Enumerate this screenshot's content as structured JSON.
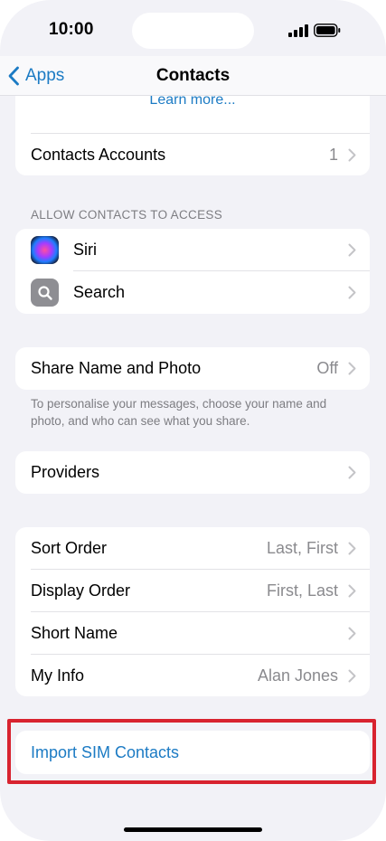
{
  "status_bar": {
    "time": "10:00"
  },
  "nav": {
    "back_label": "Apps",
    "title": "Contacts"
  },
  "top_card": {
    "learn_more": "Learn more...",
    "accounts_label": "Contacts Accounts",
    "accounts_value": "1"
  },
  "access_section": {
    "header": "ALLOW CONTACTS TO ACCESS",
    "items": [
      {
        "label": "Siri",
        "icon": "siri-icon"
      },
      {
        "label": "Search",
        "icon": "magnifier-icon"
      }
    ]
  },
  "share_section": {
    "label": "Share Name and Photo",
    "value": "Off",
    "footer": "To personalise your messages, choose your name and photo, and who can see what you share."
  },
  "providers": {
    "label": "Providers"
  },
  "settings_rows": [
    {
      "label": "Sort Order",
      "value": "Last, First"
    },
    {
      "label": "Display Order",
      "value": "First, Last"
    },
    {
      "label": "Short Name",
      "value": ""
    },
    {
      "label": "My Info",
      "value": "Alan Jones"
    }
  ],
  "import": {
    "label": "Import SIM Contacts"
  },
  "colors": {
    "accent": "#1c7bc4",
    "background": "#f2f2f7",
    "highlight": "#d8232f"
  }
}
